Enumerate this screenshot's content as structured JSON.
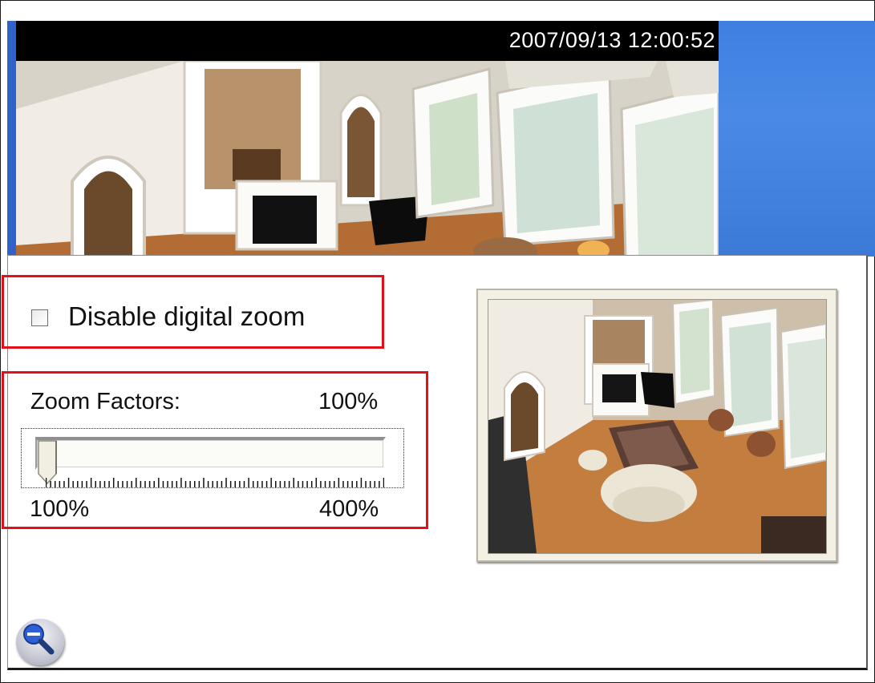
{
  "video": {
    "timestamp": "2007/09/13 12:00:52"
  },
  "dialog": {
    "disable_zoom": {
      "label": "Disable digital zoom",
      "checked": false
    },
    "zoom": {
      "label": "Zoom Factors:",
      "current_value": "100%",
      "slider_position": 0,
      "min_label": "100%",
      "max_label": "400%"
    }
  },
  "icons": {
    "zoom_out": "magnifier-minus-icon"
  },
  "colors": {
    "highlight": "#e3101a",
    "desktop_blue": "#4a8ae6"
  }
}
